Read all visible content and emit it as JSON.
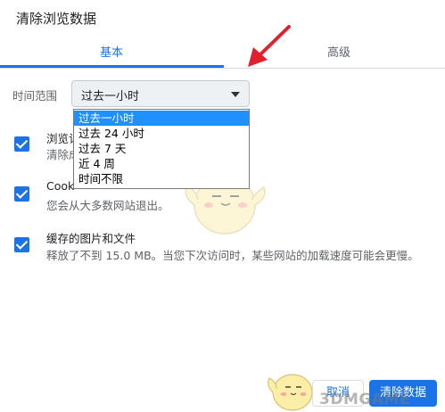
{
  "dialog": {
    "title": "清除浏览数据"
  },
  "tabs": [
    {
      "label": "基本"
    },
    {
      "label": "高级"
    }
  ],
  "time_range": {
    "label": "时间范围",
    "selected": "过去一小时",
    "options": [
      "过去一小时",
      "过去 24 小时",
      "过去 7 天",
      "近 4 周",
      "时间不限"
    ]
  },
  "items": [
    {
      "title": "浏览记",
      "desc": "清除成",
      "checked": true
    },
    {
      "title": "Cook",
      "desc": "您会从大多数网站退出。",
      "checked": true
    },
    {
      "title": "缓存的图片和文件",
      "desc": "释放了不到 15.0 MB。当您下次访问时，某些网站的加载速度可能会更慢。",
      "checked": true
    }
  ],
  "footer": {
    "cancel_label": "取消",
    "clear_label": "清除数据"
  },
  "watermark": "3DMGAME",
  "colors": {
    "accent": "#1a73e8",
    "annotation_arrow": "#e0202a"
  }
}
